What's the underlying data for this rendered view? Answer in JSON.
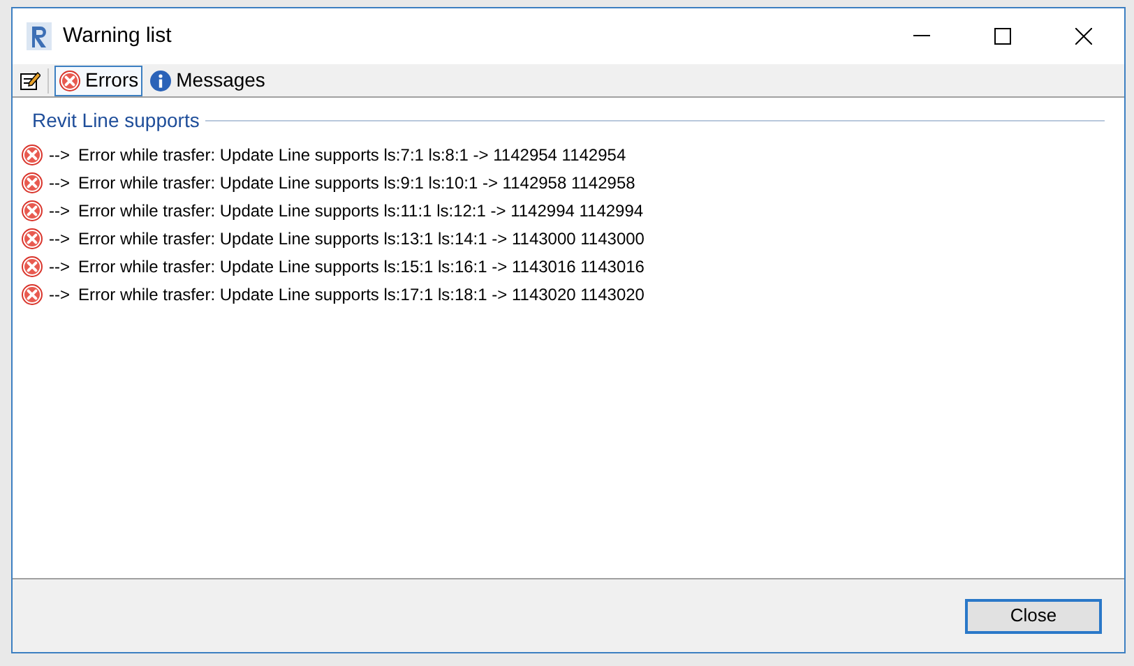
{
  "window": {
    "title": "Warning list"
  },
  "tabs": [
    {
      "label": "Errors",
      "kind": "error",
      "selected": true
    },
    {
      "label": "Messages",
      "kind": "info",
      "selected": false
    }
  ],
  "group": {
    "title": "Revit Line supports"
  },
  "rows": [
    {
      "arrow": "-->",
      "text": "Error while trasfer: Update Line supports ls:7:1 ls:8:1 -> 1142954 1142954"
    },
    {
      "arrow": "-->",
      "text": "Error while trasfer: Update Line supports ls:9:1 ls:10:1 -> 1142958 1142958"
    },
    {
      "arrow": "-->",
      "text": "Error while trasfer: Update Line supports ls:11:1 ls:12:1 -> 1142994 1142994"
    },
    {
      "arrow": "-->",
      "text": "Error while trasfer: Update Line supports ls:13:1 ls:14:1 -> 1143000 1143000"
    },
    {
      "arrow": "-->",
      "text": "Error while trasfer: Update Line supports ls:15:1 ls:16:1 -> 1143016 1143016"
    },
    {
      "arrow": "-->",
      "text": "Error while trasfer: Update Line supports ls:17:1 ls:18:1 -> 1143020 1143020"
    }
  ],
  "footer": {
    "button": "Close"
  }
}
